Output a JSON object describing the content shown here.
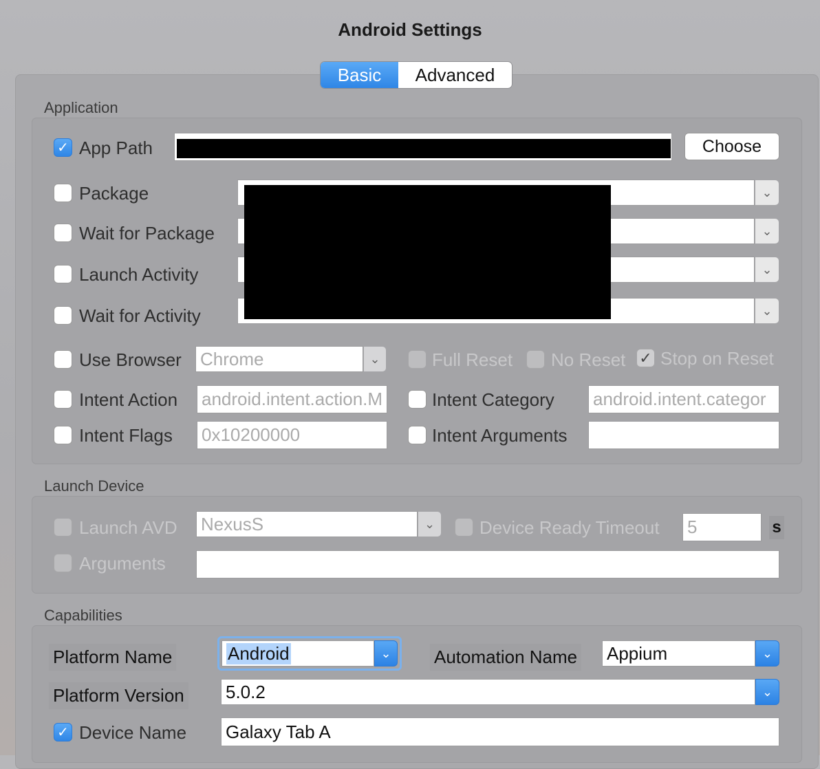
{
  "window": {
    "title": "Android Settings"
  },
  "tabs": [
    {
      "label": "Basic",
      "selected": true
    },
    {
      "label": "Advanced",
      "selected": false
    }
  ],
  "application": {
    "section_label": "Application",
    "app_path": {
      "label": "App Path",
      "checked": true,
      "value": ""
    },
    "choose_label": "Choose",
    "package": {
      "label": "Package",
      "checked": false
    },
    "wait_for_package": {
      "label": "Wait for Package",
      "checked": false
    },
    "launch_activity": {
      "label": "Launch Activity",
      "checked": false
    },
    "wait_for_activity": {
      "label": "Wait for Activity",
      "checked": false
    },
    "use_browser": {
      "label": "Use Browser",
      "checked": false,
      "value": "Chrome"
    },
    "full_reset": {
      "label": "Full Reset",
      "checked": false
    },
    "no_reset": {
      "label": "No Reset",
      "checked": false
    },
    "stop_on_reset": {
      "label": "Stop on Reset",
      "checked": true
    },
    "intent_action": {
      "label": "Intent Action",
      "checked": false,
      "placeholder": "android.intent.action.M"
    },
    "intent_category": {
      "label": "Intent Category",
      "checked": false,
      "placeholder": "android.intent.categor"
    },
    "intent_flags": {
      "label": "Intent Flags",
      "checked": false,
      "placeholder": "0x10200000"
    },
    "intent_arguments": {
      "label": "Intent Arguments",
      "checked": false,
      "value": ""
    }
  },
  "launch_device": {
    "section_label": "Launch Device",
    "launch_avd": {
      "label": "Launch AVD",
      "checked": false,
      "value": "NexusS"
    },
    "device_ready_timeout": {
      "label": "Device Ready Timeout",
      "checked": false,
      "placeholder": "5",
      "unit": "s"
    },
    "arguments": {
      "label": "Arguments",
      "checked": false,
      "value": ""
    }
  },
  "capabilities": {
    "section_label": "Capabilities",
    "platform_name": {
      "label": "Platform Name",
      "value": "Android"
    },
    "automation_name": {
      "label": "Automation Name",
      "value": "Appium"
    },
    "platform_version": {
      "label": "Platform Version",
      "value": "5.0.2"
    },
    "device_name": {
      "label": "Device Name",
      "checked": true,
      "value": "Galaxy Tab A"
    }
  },
  "icons": {
    "checkmark": "✓",
    "chevron": "⌄"
  },
  "colors": {
    "accent": "#2f86e6",
    "panel": "#a4a4a7"
  }
}
